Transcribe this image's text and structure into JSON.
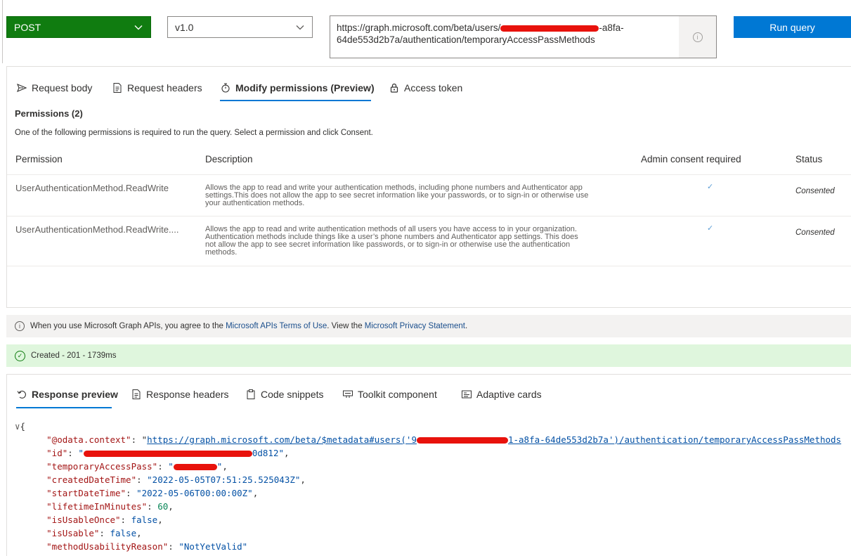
{
  "query": {
    "method": "POST",
    "version": "v1.0",
    "url_line1_prefix": "https://graph.microsoft.com/beta/users/",
    "url_line1_suffix": "-a8fa-",
    "url_line2": "64de553d2b7a/authentication/temporaryAccessPassMethods",
    "run_label": "Run query"
  },
  "request_tabs": [
    {
      "label": "Request body",
      "icon": "send-icon"
    },
    {
      "label": "Request headers",
      "icon": "document-icon"
    },
    {
      "label": "Modify permissions (Preview)",
      "icon": "permission-icon"
    },
    {
      "label": "Access token",
      "icon": "lock-icon"
    }
  ],
  "permissions": {
    "title": "Permissions (2)",
    "subtitle": "One of the following permissions is required to run the query. Select a permission and click Consent.",
    "columns": [
      "Permission",
      "Description",
      "Admin consent required",
      "Status"
    ],
    "rows": [
      {
        "name": "UserAuthenticationMethod.ReadWrite",
        "description": [
          "Allows the app to read and write your authentication methods, including phone numbers and Authenticator app",
          "settings.This does not allow the app to see secret information like your passwords, or to sign-in or otherwise use",
          "your authentication methods."
        ],
        "admin": "✓",
        "status": "Consented"
      },
      {
        "name": "UserAuthenticationMethod.ReadWrite....",
        "description": [
          "Allows the app to read and write authentication methods of all users you have access to in your organization.",
          "Authentication methods include things like a user’s phone numbers and Authenticator app settings. This does",
          "not allow the app to see secret information like passwords, or to sign-in or otherwise use the authentication",
          "methods."
        ],
        "admin": "✓",
        "status": "Consented"
      }
    ]
  },
  "terms": {
    "pre": "When you use Microsoft Graph APIs, you agree to the",
    "link1": "Microsoft APIs Terms of Use",
    "mid": ". View the",
    "link2": "Microsoft Privacy Statement",
    "post": "."
  },
  "status_text": "Created - 201 - 1739ms",
  "response_tabs": [
    {
      "label": "Response preview",
      "icon": "undo-icon"
    },
    {
      "label": "Response headers",
      "icon": "document-icon"
    },
    {
      "label": "Code snippets",
      "icon": "clipboard-icon"
    },
    {
      "label": "Toolkit component",
      "icon": "toolkit-icon"
    },
    {
      "label": "Adaptive cards",
      "icon": "card-icon"
    }
  ],
  "response_json": {
    "context_key": "\"@odata.context\"",
    "context_prefix": "https://graph.microsoft.com/beta/$metadata#users('9",
    "context_suffix": "1-a8fa-64de553d2b7a')/authentication/temporaryAccessPassMethods",
    "id_key": "\"id\"",
    "id_suffix": "0d812\"",
    "tap_key": "\"temporaryAccessPass\"",
    "tap_value_suffix": "\"",
    "created_key": "\"createdDateTime\"",
    "created_value": "\"2022-05-05T07:51:25.525043Z\"",
    "start_key": "\"startDateTime\"",
    "start_value": "\"2022-05-06T00:00:00Z\"",
    "lifetime_key": "\"lifetimeInMinutes\"",
    "lifetime_value": "60",
    "once_key": "\"isUsableOnce\"",
    "once_value": "false",
    "usable_key": "\"isUsable\"",
    "usable_value": "false",
    "reason_key": "\"methodUsabilityReason\"",
    "reason_value": "\"NotYetValid\""
  }
}
